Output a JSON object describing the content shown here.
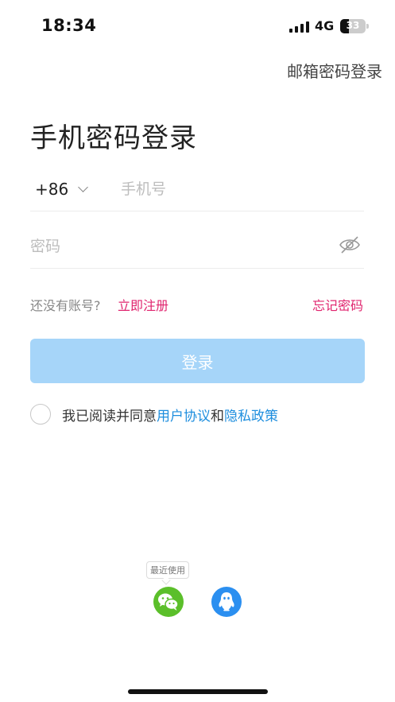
{
  "status_bar": {
    "time": "18:34",
    "network": "4G",
    "battery": "33",
    "battery_level": 0.33
  },
  "header": {
    "email_login_label": "邮箱密码登录"
  },
  "title": "手机密码登录",
  "phone": {
    "country_code": "+86",
    "placeholder": "手机号",
    "value": ""
  },
  "password": {
    "placeholder": "密码",
    "value": ""
  },
  "links": {
    "no_account": "还没有账号?",
    "register": "立即注册",
    "forgot_password": "忘记密码"
  },
  "login_button": "登录",
  "agreement": {
    "checked": false,
    "prefix": "我已阅读并同意",
    "user_agreement": "用户协议",
    "and": "和",
    "privacy_policy": "隐私政策"
  },
  "social": {
    "recent_badge": "最近使用",
    "icons": [
      "wechat-icon",
      "qq-icon"
    ],
    "colors": {
      "wechat": "#5bbf2a",
      "qq": "#2b8ff0"
    }
  },
  "colors": {
    "accent_pink": "#e0246e",
    "link_blue": "#1e8ede",
    "button_disabled": "#a6d5f9"
  }
}
